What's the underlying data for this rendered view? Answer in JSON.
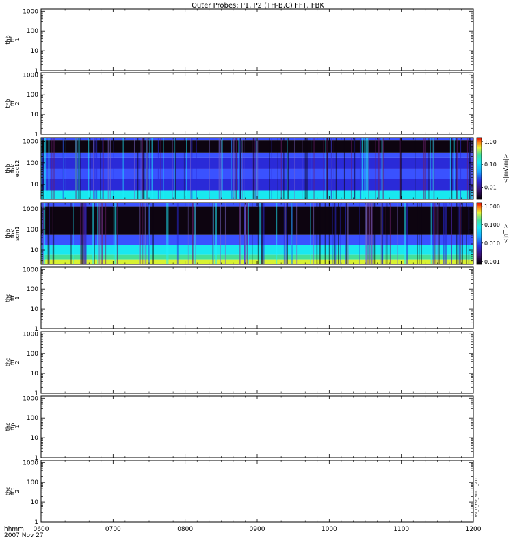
{
  "title": "Outer Probes: P1, P2 (TH-B,C) FFT, FBK",
  "x_axis": {
    "label_line1": "hhmm",
    "label_line2": "2007 Nov 27",
    "ticks": [
      "0600",
      "0700",
      "0800",
      "0900",
      "1000",
      "1100",
      "1200"
    ]
  },
  "y_ticks": [
    "1",
    "10",
    "100",
    "1000"
  ],
  "y_ticks_1000_variant": [
    "10",
    "100",
    "1000"
  ],
  "side_note": "tha_l2_fbk_2007..._v01",
  "chart_data": [
    {
      "type": "line",
      "name": "thb fff 1",
      "ylabel": [
        "thb",
        "fff",
        "1"
      ],
      "yscale": "log",
      "ylim": [
        1,
        1300
      ],
      "xlim": [
        "0600",
        "1200"
      ],
      "series": []
    },
    {
      "type": "line",
      "name": "thb fff 2",
      "ylabel": [
        "thb",
        "fff",
        "2"
      ],
      "yscale": "log",
      "ylim": [
        1,
        1300
      ],
      "xlim": [
        "0600",
        "1200"
      ],
      "series": []
    },
    {
      "type": "heatmap",
      "name": "thb fbk edc12",
      "ylabel": [
        "thb",
        "fbk",
        "edc12"
      ],
      "yscale": "log",
      "ylim": [
        2,
        1500
      ],
      "xlim": [
        "0600",
        "1200"
      ],
      "bands": [
        {
          "y0": 1500,
          "y1": 1100,
          "level": "blue"
        },
        {
          "y0": 1100,
          "y1": 300,
          "level": "black"
        },
        {
          "y0": 300,
          "y1": 180,
          "level": "blue"
        },
        {
          "y0": 180,
          "y1": 55,
          "level": "blue-dark"
        },
        {
          "y0": 55,
          "y1": 17,
          "level": "blue"
        },
        {
          "y0": 17,
          "y1": 5,
          "level": "blue-dark"
        },
        {
          "y0": 5,
          "y1": 2,
          "level": "cyan"
        }
      ],
      "colorbar": {
        "label": "<|mV/m|>",
        "scale": "log",
        "range": [
          0.003,
          1.5
        ],
        "ticks": [
          "1.00",
          "0.10",
          "0.01"
        ]
      }
    },
    {
      "type": "heatmap",
      "name": "thb fbk scm1",
      "ylabel": [
        "thb",
        "fbk",
        "scm1"
      ],
      "yscale": "log",
      "ylim": [
        2,
        2000
      ],
      "xlim": [
        "0600",
        "1200"
      ],
      "bands": [
        {
          "y0": 2000,
          "y1": 1300,
          "level": "blue"
        },
        {
          "y0": 1300,
          "y1": 55,
          "level": "black"
        },
        {
          "y0": 55,
          "y1": 18,
          "level": "blue"
        },
        {
          "y0": 18,
          "y1": 6,
          "level": "cyan"
        },
        {
          "y0": 6,
          "y1": 3.5,
          "level": "green"
        },
        {
          "y0": 3.5,
          "y1": 2,
          "level": "yellow"
        }
      ],
      "colorbar": {
        "label": "<|nT|>",
        "scale": "log",
        "range": [
          0.0007,
          1.5
        ],
        "ticks": [
          "1.000",
          "0.100",
          "0.010",
          "0.001"
        ]
      }
    },
    {
      "type": "line",
      "name": "thc fff 1",
      "ylabel": [
        "thc",
        "fff",
        "1"
      ],
      "yscale": "log",
      "ylim": [
        1,
        1300
      ],
      "xlim": [
        "0600",
        "1200"
      ],
      "series": []
    },
    {
      "type": "line",
      "name": "thc fff 2",
      "ylabel": [
        "thc",
        "fff",
        "2"
      ],
      "yscale": "log",
      "ylim": [
        1,
        1300
      ],
      "xlim": [
        "0600",
        "1200"
      ],
      "series": []
    },
    {
      "type": "line",
      "name": "thc ffp 1",
      "ylabel": [
        "thc",
        "ffp",
        "1"
      ],
      "yscale": "log",
      "ylim": [
        1,
        1300
      ],
      "xlim": [
        "0600",
        "1200"
      ],
      "series": []
    },
    {
      "type": "line",
      "name": "thc ffp 2",
      "ylabel": [
        "thc",
        "ffp",
        "2"
      ],
      "yscale": "log",
      "ylim": [
        1,
        1300
      ],
      "xlim": [
        "0600",
        "1200"
      ],
      "series": []
    }
  ]
}
